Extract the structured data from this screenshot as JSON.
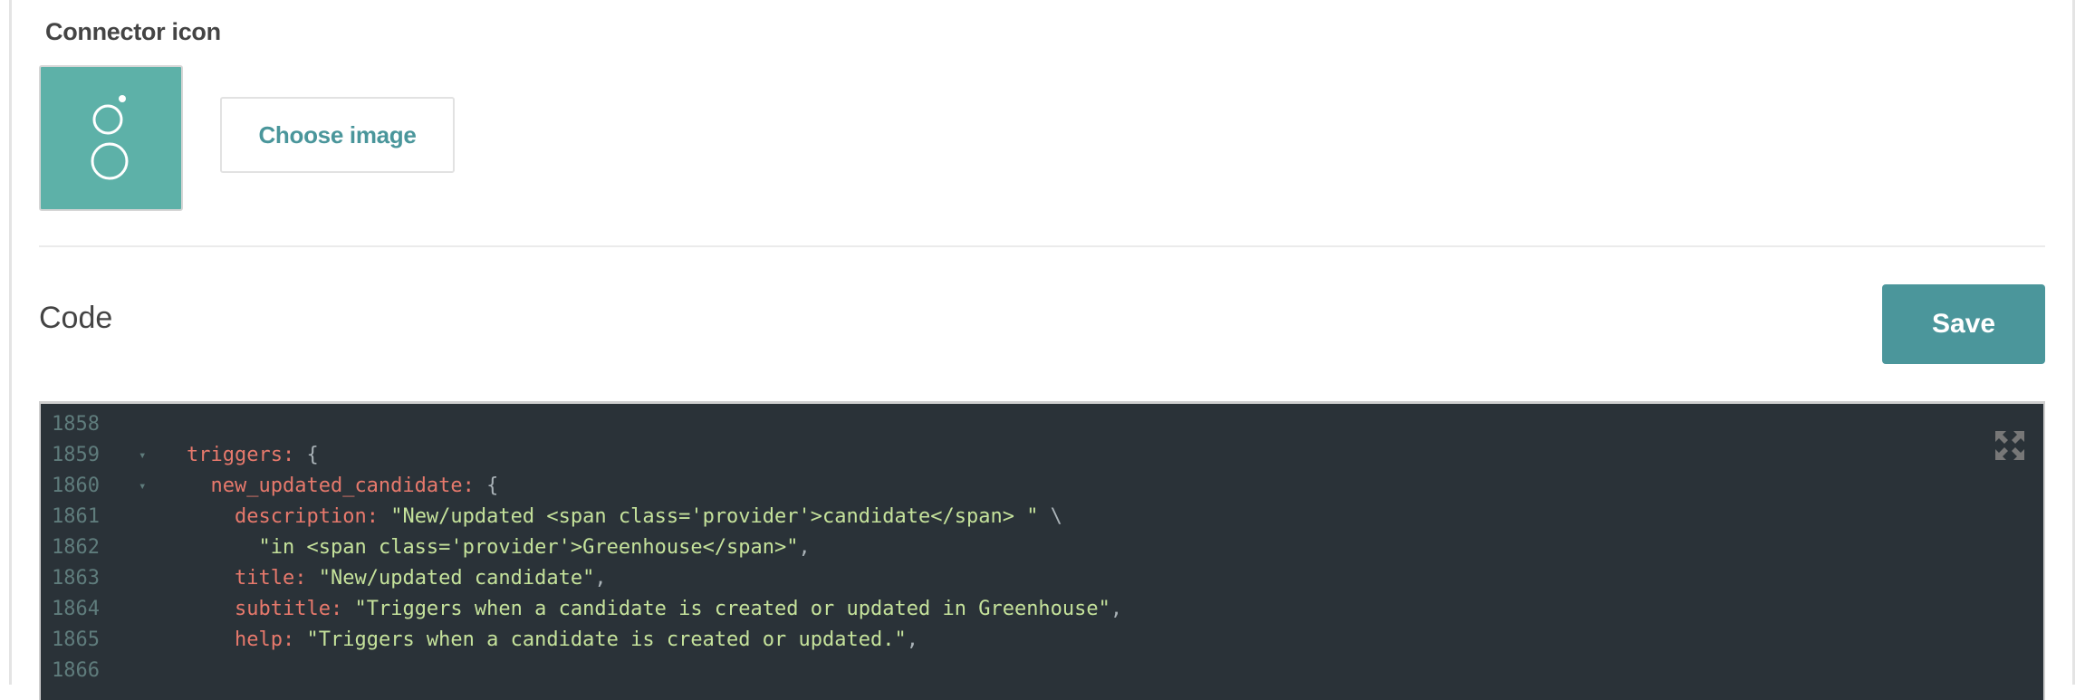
{
  "connector_icon": {
    "title": "Connector icon",
    "icon_name": "greenhouse-logo",
    "icon_bg": "#5db1a8",
    "choose_label": "Choose image"
  },
  "code_section": {
    "title": "Code",
    "save_label": "Save",
    "accent": "#4b969b",
    "expand_icon": "expand-arrows-icon",
    "lines": [
      {
        "num": "1858",
        "fold": false,
        "indent": 0,
        "tokens": []
      },
      {
        "num": "1859",
        "fold": true,
        "indent": 2,
        "tokens": [
          {
            "t": "key",
            "v": "triggers:"
          },
          {
            "t": "punc",
            "v": " {"
          }
        ]
      },
      {
        "num": "1860",
        "fold": true,
        "indent": 4,
        "tokens": [
          {
            "t": "key",
            "v": "new_updated_candidate:"
          },
          {
            "t": "punc",
            "v": " {"
          }
        ]
      },
      {
        "num": "1861",
        "fold": false,
        "indent": 6,
        "tokens": [
          {
            "t": "key",
            "v": "description:"
          },
          {
            "t": "str",
            "v": " \"New/updated <span class='provider'>candidate</span> \""
          },
          {
            "t": "punc",
            "v": " \\"
          }
        ]
      },
      {
        "num": "1862",
        "fold": false,
        "indent": 8,
        "tokens": [
          {
            "t": "str",
            "v": "\"in <span class='provider'>Greenhouse</span>\""
          },
          {
            "t": "punc",
            "v": ","
          }
        ]
      },
      {
        "num": "1863",
        "fold": false,
        "indent": 6,
        "tokens": [
          {
            "t": "key",
            "v": "title:"
          },
          {
            "t": "str",
            "v": " \"New/updated candidate\""
          },
          {
            "t": "punc",
            "v": ","
          }
        ]
      },
      {
        "num": "1864",
        "fold": false,
        "indent": 6,
        "tokens": [
          {
            "t": "key",
            "v": "subtitle:"
          },
          {
            "t": "str",
            "v": " \"Triggers when a candidate is created or updated in Greenhouse\""
          },
          {
            "t": "punc",
            "v": ","
          }
        ]
      },
      {
        "num": "1865",
        "fold": false,
        "indent": 6,
        "tokens": [
          {
            "t": "key",
            "v": "help:"
          },
          {
            "t": "str",
            "v": " \"Triggers when a candidate is created or updated.\""
          },
          {
            "t": "punc",
            "v": ","
          }
        ]
      },
      {
        "num": "1866",
        "fold": false,
        "indent": 0,
        "tokens": []
      }
    ]
  }
}
